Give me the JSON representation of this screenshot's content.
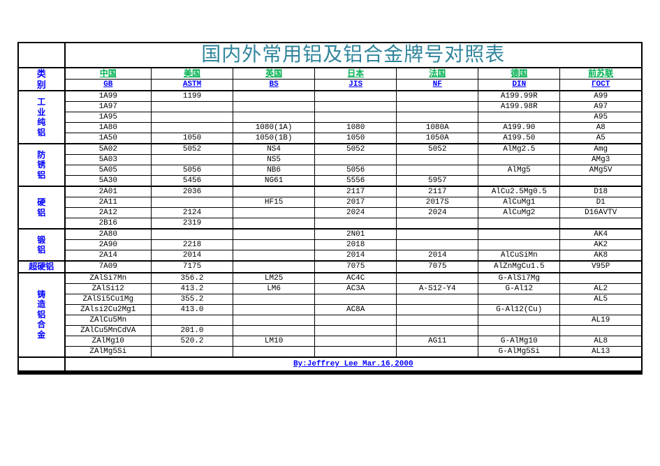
{
  "title": "国内外常用铝及铝合金牌号对照表",
  "header": {
    "cat_label": [
      "类",
      "别"
    ],
    "countries": [
      "中国",
      "美国",
      "英国",
      "日本",
      "法国",
      "德国",
      "前苏联"
    ],
    "standards": [
      "GB",
      "ASTM",
      "BS",
      "JIS",
      "NF",
      "DIN",
      "ГОСТ"
    ]
  },
  "sections": [
    {
      "label": [
        "工",
        "业",
        "纯",
        "铝"
      ],
      "rows": [
        [
          "1A99",
          "1199",
          "",
          "",
          "",
          "A199.99R",
          "A99"
        ],
        [
          "1A97",
          "",
          "",
          "",
          "",
          "A199.98R",
          "A97"
        ],
        [
          "1A95",
          "",
          "",
          "",
          "",
          "",
          "A95"
        ],
        [
          "1A80",
          "",
          "1080(1A)",
          "1080",
          "1080A",
          "A199.90",
          "A8"
        ],
        [
          "1A50",
          "1050",
          "1050(1B)",
          "1050",
          "1050A",
          "A199.50",
          "A5"
        ]
      ]
    },
    {
      "label": [
        "防",
        "锈",
        "铝"
      ],
      "rows": [
        [
          "5A02",
          "5052",
          "NS4",
          "5052",
          "5052",
          "AlMg2.5",
          "Amg"
        ],
        [
          "5A03",
          "",
          "NS5",
          "",
          "",
          "",
          "AMg3"
        ],
        [
          "5A05",
          "5056",
          "NB6",
          "5056",
          "",
          "AlMg5",
          "AMg5V"
        ],
        [
          "5A30",
          "5456",
          "NG61",
          "5556",
          "5957",
          "",
          ""
        ]
      ]
    },
    {
      "label": [
        "硬",
        "铝"
      ],
      "rows": [
        [
          "2A01",
          "2036",
          "",
          "2117",
          "2117",
          "AlCu2.5Mg0.5",
          "D18"
        ],
        [
          "2A11",
          "",
          "HF15",
          "2017",
          "2017S",
          "AlCuMg1",
          "D1"
        ],
        [
          "2A12",
          "2124",
          "",
          "2024",
          "2024",
          "AlCuMg2",
          "D16AVTV"
        ],
        [
          "2B16",
          "2319",
          "",
          "",
          "",
          "",
          ""
        ]
      ]
    },
    {
      "label": [
        "锻",
        "",
        "铝"
      ],
      "rows": [
        [
          "2A80",
          "",
          "",
          "2N01",
          "",
          "",
          "AK4"
        ],
        [
          "2A90",
          "2218",
          "",
          "2018",
          "",
          "",
          "AK2"
        ],
        [
          "2A14",
          "2014",
          "",
          "2014",
          "2014",
          "AlCuSiMn",
          "AK8"
        ]
      ]
    },
    {
      "label": [
        "超硬铝"
      ],
      "special_closed": true,
      "rows": [
        [
          "7A09",
          "7175",
          "",
          "7075",
          "7075",
          "AlZnMgCu1.5",
          "V95P"
        ]
      ]
    },
    {
      "label": [
        "铸",
        "造",
        "铝",
        "合",
        "金"
      ],
      "rows": [
        [
          "ZAlSi7Mn",
          "356.2",
          "LM25",
          "AC4C",
          "",
          "G-AlSi7Mg",
          ""
        ],
        [
          "ZAlSi12",
          "413.2",
          "LM6",
          "AC3A",
          "A-S12-Y4",
          "G-Al12",
          "AL2"
        ],
        [
          "ZAlSi5Cu1Mg",
          "355.2",
          "",
          "",
          "",
          "",
          "AL5"
        ],
        [
          "ZAlsi2Cu2Mg1",
          "413.0",
          "",
          "AC8A",
          "",
          "G-Al12(Cu)",
          ""
        ],
        [
          "ZAlCu5Mn",
          "",
          "",
          "",
          "",
          "",
          "AL19"
        ],
        [
          "ZAlCu5MnCdVA",
          "201.0",
          "",
          "",
          "",
          "",
          ""
        ],
        [
          "ZAlMg10",
          "520.2",
          "LM10",
          "",
          "AG11",
          "G-AlMg10",
          "AL8"
        ],
        [
          "ZAlMg5Si",
          "",
          "",
          "",
          "",
          "G-AlMg5Si",
          "AL13"
        ]
      ]
    }
  ],
  "byline": "By:Jeffrey Lee Mar.16,2000"
}
